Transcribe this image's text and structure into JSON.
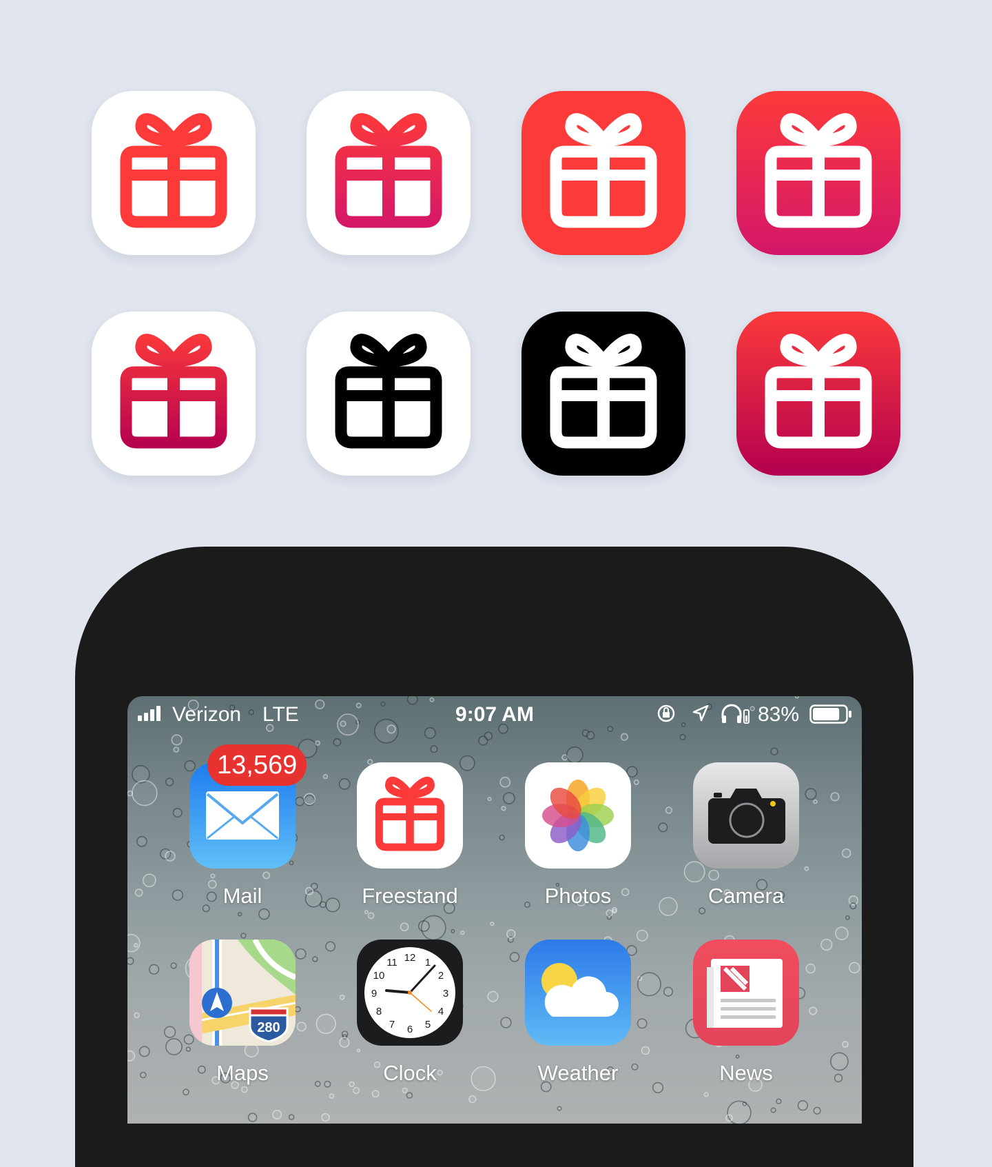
{
  "colors": {
    "background": "#e0e5ee",
    "gift_red": "#fd3a3a",
    "gift_pink": "#d4166a",
    "gift_crimson": "#b40050",
    "black": "#000000",
    "white": "#ffffff"
  },
  "icon_variants": [
    {
      "name": "gift-white-red",
      "background": "white",
      "glyph": "red"
    },
    {
      "name": "gift-white-gradient",
      "background": "white",
      "glyph": "red-pink-gradient"
    },
    {
      "name": "gift-red-white",
      "background": "red",
      "glyph": "white"
    },
    {
      "name": "gift-gradient-white",
      "background": "red-pink-gradient",
      "glyph": "white"
    },
    {
      "name": "gift-white-crimson",
      "background": "white",
      "glyph": "red-crimson-gradient"
    },
    {
      "name": "gift-white-black",
      "background": "white",
      "glyph": "black"
    },
    {
      "name": "gift-black-white",
      "background": "black",
      "glyph": "white"
    },
    {
      "name": "gift-crimson-white",
      "background": "red-crimson-gradient",
      "glyph": "white"
    }
  ],
  "statusbar": {
    "carrier": "Verizon",
    "network": "LTE",
    "time": "9:07 AM",
    "battery_percent": "83%",
    "battery_level": 0.83,
    "icons": [
      "signal-icon",
      "orientation-lock-icon",
      "location-icon",
      "headphones-icon",
      "battery-icon"
    ]
  },
  "apps": [
    {
      "label": "Mail",
      "icon": "mail-icon",
      "badge": "13,569"
    },
    {
      "label": "Freestand",
      "icon": "gift-icon"
    },
    {
      "label": "Photos",
      "icon": "photos-icon"
    },
    {
      "label": "Camera",
      "icon": "camera-icon"
    },
    {
      "label": "Maps",
      "icon": "maps-icon",
      "road_sign": "280"
    },
    {
      "label": "Clock",
      "icon": "clock-icon",
      "numbers": [
        "12",
        "1",
        "2",
        "3",
        "4",
        "5",
        "6",
        "7",
        "8",
        "9",
        "10",
        "11"
      ]
    },
    {
      "label": "Weather",
      "icon": "weather-icon"
    },
    {
      "label": "News",
      "icon": "news-icon"
    }
  ]
}
